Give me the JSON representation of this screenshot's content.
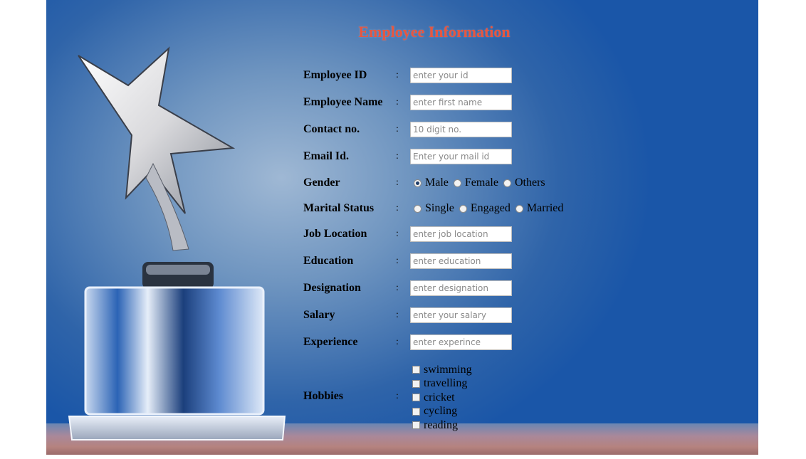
{
  "form": {
    "title": "Employee Information",
    "fields": [
      {
        "label": "Employee ID",
        "placeholder": "enter your id"
      },
      {
        "label": "Employee Name",
        "placeholder": "enter first name"
      },
      {
        "label": "Contact no.",
        "placeholder": "10 digit no."
      },
      {
        "label": "Email Id.",
        "placeholder": "Enter your mail id"
      },
      {
        "label": "Job Location",
        "placeholder": "enter job location"
      },
      {
        "label": "Education",
        "placeholder": "enter education"
      },
      {
        "label": "Designation",
        "placeholder": "enter designation"
      },
      {
        "label": "Salary",
        "placeholder": "enter your salary"
      },
      {
        "label": "Experience",
        "placeholder": "enter experince"
      }
    ],
    "gender": {
      "label": "Gender",
      "options": [
        "Male",
        "Female",
        "Others"
      ],
      "selected": "Male"
    },
    "marital_status": {
      "label": "Marital Status",
      "options": [
        "Single",
        "Engaged",
        "Married"
      ],
      "selected": null
    },
    "hobbies": {
      "label": "Hobbies",
      "options": [
        "swimming",
        "travelling",
        "cricket",
        "cycling",
        "reading"
      ],
      "checked": []
    },
    "separator": ":"
  },
  "background": {
    "image": "trophy-star-icon",
    "accent_title_color": "#e8563f",
    "backdrop_color": "#1a56a8"
  }
}
